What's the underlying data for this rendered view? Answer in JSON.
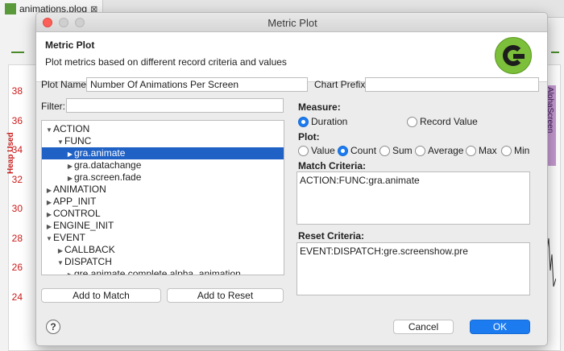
{
  "editor": {
    "tab_label": "animations.plog",
    "close_glyph": "⊠",
    "y_ticks": [
      "38",
      "36",
      "34",
      "32",
      "30",
      "28",
      "26",
      "24"
    ],
    "y_axis_label": "Heap Used",
    "right_label": "AlphaScreen"
  },
  "dialog": {
    "window_title": "Metric Plot",
    "header_title": "Metric Plot",
    "header_description": "Plot metrics based on different record criteria and values",
    "plot_name_label": "Plot Name:",
    "plot_name_value": "Number Of Animations Per Screen",
    "chart_prefix_label": "Chart Prefix:",
    "chart_prefix_value": "",
    "filter_label": "Filter:",
    "filter_value": "",
    "tree": [
      {
        "label": "ACTION",
        "twisty": "▼"
      },
      {
        "label": "FUNC",
        "twisty": "▼"
      },
      {
        "label": "gra.animate",
        "twisty": "▶"
      },
      {
        "label": "gra.datachange",
        "twisty": "▶"
      },
      {
        "label": "gra.screen.fade",
        "twisty": "▶"
      },
      {
        "label": "ANIMATION",
        "twisty": "▶"
      },
      {
        "label": "APP_INIT",
        "twisty": "▶"
      },
      {
        "label": "CONTROL",
        "twisty": "▶"
      },
      {
        "label": "ENGINE_INIT",
        "twisty": "▶"
      },
      {
        "label": "EVENT",
        "twisty": "▼"
      },
      {
        "label": "CALLBACK",
        "twisty": "▶"
      },
      {
        "label": "DISPATCH",
        "twisty": "▼"
      },
      {
        "label": "gre.animate.complete.alpha_animation",
        "twisty": "▶"
      }
    ],
    "add_to_match_label": "Add to Match",
    "add_to_reset_label": "Add to Reset",
    "measure_label": "Measure:",
    "measure_options": [
      "Duration",
      "Record Value"
    ],
    "measure_selected": "Duration",
    "plot_label": "Plot:",
    "plot_options": [
      "Value",
      "Count",
      "Sum",
      "Average",
      "Max",
      "Min"
    ],
    "plot_selected": "Count",
    "match_criteria_label": "Match Criteria:",
    "match_criteria_value": "ACTION:FUNC:gra.animate",
    "reset_criteria_label": "Reset Criteria:",
    "reset_criteria_value": "EVENT:DISPATCH:gre.screenshow.pre",
    "help_glyph": "?",
    "cancel_label": "Cancel",
    "ok_label": "OK"
  },
  "colors": {
    "selection": "#1f61c5",
    "primary_button": "#1b7bef",
    "axis_red": "#cc1a1a",
    "logo_green": "#7cbf3a"
  }
}
